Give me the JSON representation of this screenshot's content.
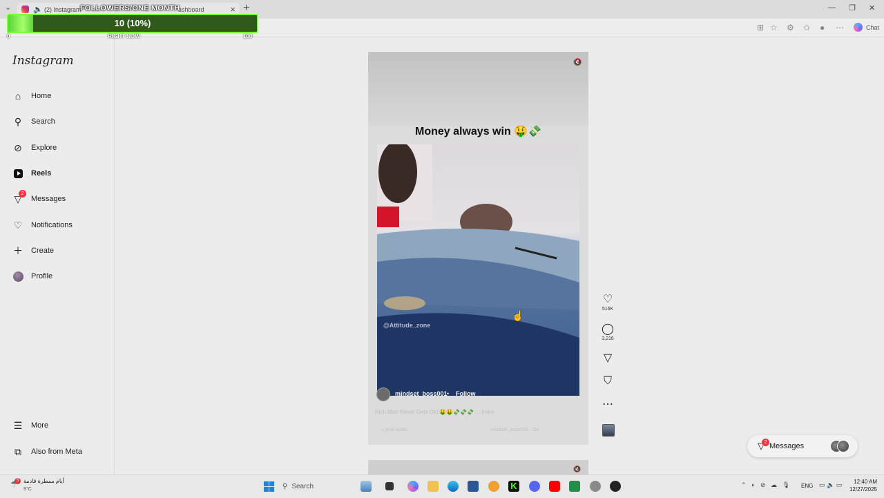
{
  "browser": {
    "tab_title": "(2) Instagram",
    "tab_title_2": "ashboard",
    "chat_label": "Chat"
  },
  "overlay": {
    "title": "FOLLOWERS/ONE MONTH",
    "progress_text": "10 (10%)",
    "progress_fraction": 0.1,
    "label_min": "0",
    "label_mid": "RIGHT NOW",
    "label_max": "100"
  },
  "sidebar": {
    "logo": "Instagram",
    "items": [
      {
        "label": "Home",
        "icon": "home-icon"
      },
      {
        "label": "Search",
        "icon": "search-icon"
      },
      {
        "label": "Explore",
        "icon": "explore-icon"
      },
      {
        "label": "Reels",
        "icon": "reels-icon"
      },
      {
        "label": "Messages",
        "icon": "messages-icon",
        "badge": "2"
      },
      {
        "label": "Notifications",
        "icon": "heart-icon"
      },
      {
        "label": "Create",
        "icon": "plus-icon"
      },
      {
        "label": "Profile",
        "icon": "avatar"
      }
    ],
    "more_label": "More",
    "meta_label": "Also from Meta"
  },
  "reel": {
    "title": "Money always win 🤑💸",
    "watermark": "@Attitude_zone",
    "username": "mindset_boss001",
    "follow_label": "Follow",
    "caption": "Rich Man Never Gets Old 🤑🤑💸💸💸 ... more",
    "audio_left": "♫ jinal audio",
    "audio_right": "mindset_boss001 · Ori",
    "likes": "516K",
    "comments": "3,216"
  },
  "messages_pill": {
    "label": "Messages",
    "badge": "2"
  },
  "taskbar": {
    "weather_text": "أيام ممطرة قادمة",
    "weather_temp": "9°C",
    "weather_badge": "5",
    "search_placeholder": "Search",
    "lang": "ENG",
    "time": "12:40 AM",
    "date": "12/27/2025"
  }
}
